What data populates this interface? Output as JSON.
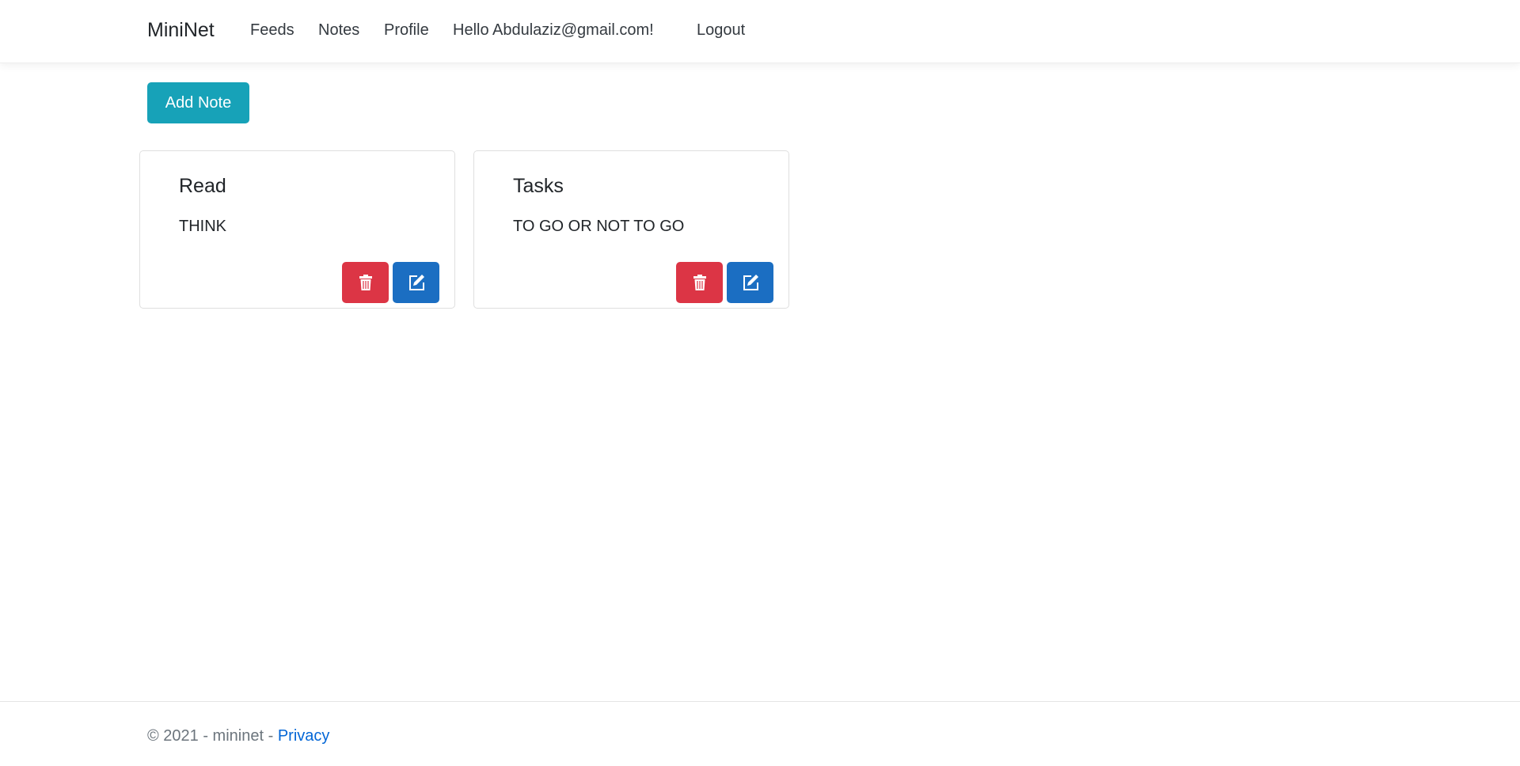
{
  "nav": {
    "brand": "MiniNet",
    "links": [
      "Feeds",
      "Notes",
      "Profile",
      "Hello Abdulaziz@gmail.com!",
      "Logout"
    ]
  },
  "add_note_label": "Add Note",
  "notes": [
    {
      "title": "Read",
      "text": "THINK"
    },
    {
      "title": "Tasks",
      "text": "TO GO OR NOT TO GO"
    }
  ],
  "footer": {
    "text": "© 2021 - mininet - ",
    "privacy": "Privacy"
  },
  "colors": {
    "add": "#17a2b8",
    "delete": "#dc3545",
    "edit": "#1b6ec2"
  }
}
